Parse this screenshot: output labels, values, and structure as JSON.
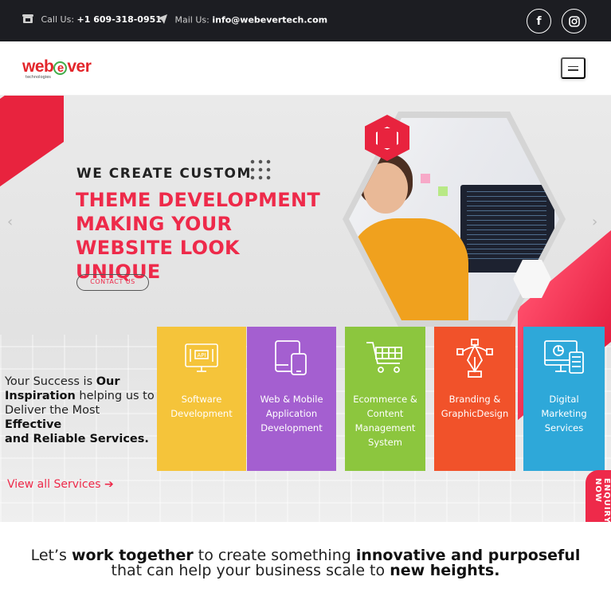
{
  "topbar": {
    "phone_label": "Call Us:",
    "phone": "+1 609-318-0951",
    "mail_label": "Mail Us:",
    "mail": "info@webevertech.com",
    "facebook_glyph": "f",
    "instagram_glyph": "◎"
  },
  "header": {
    "logo_text_1": "web",
    "logo_text_2": "e",
    "logo_text_3": "ver",
    "logo_tag": "technologies"
  },
  "hero": {
    "subtitle": "WE CREATE CUSTOM",
    "title": "THEME DEVELOPMENT MAKING YOUR WEBSITE LOOK UNIQUE",
    "cta": "CONTACT US",
    "prev": "‹",
    "next": "›"
  },
  "tagline": {
    "t1": "Your Success is ",
    "b1": "Our Inspiration",
    "t2": " helping us to",
    "t3": "Deliver the Most ",
    "b2": "Effective",
    "b3": "and Reliable Services.",
    "view_all": "View all Services",
    "view_all_arrow": "➔"
  },
  "services": [
    {
      "label": "Software Development",
      "icon": "api-monitor-icon",
      "color": "#f5c43a"
    },
    {
      "label": "Web & Mobile Application Development",
      "icon": "devices-icon",
      "color": "#a45fd0"
    },
    {
      "label": "Ecommerce & Content Management System",
      "icon": "cart-icon",
      "color": "#8cc63e"
    },
    {
      "label": "Branding & GraphicDesign",
      "icon": "pen-tool-icon",
      "color": "#f1522a"
    },
    {
      "label": "Digital Marketing Services",
      "icon": "analytics-monitor-icon",
      "color": "#2ea8d9"
    }
  ],
  "enquiry": "ENQUIRY NOW",
  "bottom": {
    "t1": "Let’s ",
    "b1": "work together",
    "t2": " to create something ",
    "b2": "innovative and purposeful",
    "t3": "that can help your business scale to ",
    "b3": "new heights."
  },
  "colors": {
    "accent": "#ee2a4a",
    "topbar_bg": "#1c1d22"
  }
}
